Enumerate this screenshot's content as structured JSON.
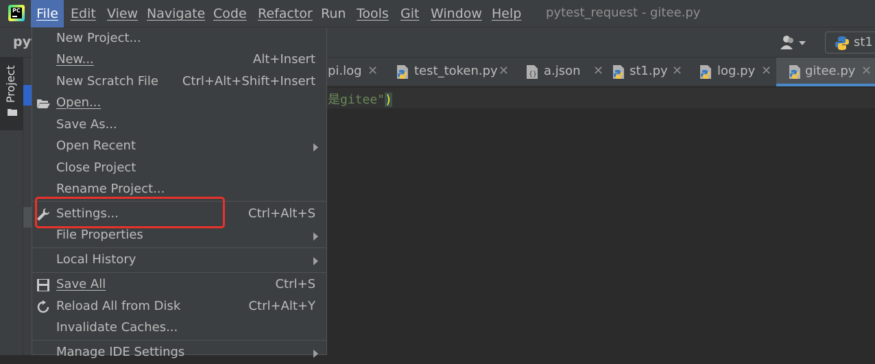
{
  "app": {
    "logo_text": "PC",
    "window_title": "pytest_request - gitee.py"
  },
  "menubar": {
    "items": [
      {
        "label": "File",
        "mnemonic": "F"
      },
      {
        "label": "Edit",
        "mnemonic": "E"
      },
      {
        "label": "View",
        "mnemonic": "V"
      },
      {
        "label": "Navigate",
        "mnemonic": "N"
      },
      {
        "label": "Code",
        "mnemonic": "C"
      },
      {
        "label": "Refactor",
        "mnemonic": "R"
      },
      {
        "label": "Run",
        "mnemonic": "u"
      },
      {
        "label": "Tools",
        "mnemonic": "T"
      },
      {
        "label": "Git",
        "mnemonic": "G"
      },
      {
        "label": "Window",
        "mnemonic": "W"
      },
      {
        "label": "Help",
        "mnemonic": "H"
      }
    ]
  },
  "navbar": {
    "project_crumb": "pyt",
    "run_config_label": "st1"
  },
  "toolstrip": {
    "project_tab_label": "Project"
  },
  "tabs": [
    {
      "label": "pi.log",
      "icon": "log-file-icon"
    },
    {
      "label": "test_token.py",
      "icon": "python-file-icon"
    },
    {
      "label": "a.json",
      "icon": "json-file-icon"
    },
    {
      "label": "st1.py",
      "icon": "python-file-icon"
    },
    {
      "label": "log.py",
      "icon": "python-file-icon"
    },
    {
      "label": "gitee.py",
      "icon": "python-file-icon",
      "active": true
    }
  ],
  "editor": {
    "code_string": "是gitee\"",
    "code_paren": ")"
  },
  "file_menu": {
    "items": [
      {
        "label": "New Project...",
        "shortcut": ""
      },
      {
        "label": "New...",
        "shortcut": "Alt+Insert",
        "underline": "N"
      },
      {
        "label": "New Scratch File",
        "shortcut": "Ctrl+Alt+Shift+Insert"
      },
      {
        "label": "Open...",
        "shortcut": "",
        "icon": "folder-open-icon",
        "underline": "O"
      },
      {
        "label": "Save As...",
        "shortcut": ""
      },
      {
        "label": "Open Recent",
        "shortcut": "",
        "submenu": true,
        "underline": "R"
      },
      {
        "label": "Close Project",
        "shortcut": ""
      },
      {
        "label": "Rename Project...",
        "shortcut": ""
      },
      {
        "label": "Settings...",
        "shortcut": "Ctrl+Alt+S",
        "icon": "wrench-icon",
        "underline": "t"
      },
      {
        "label": "File Properties",
        "shortcut": "",
        "submenu": true
      },
      {
        "label": "Local History",
        "shortcut": "",
        "submenu": true,
        "underline": "H"
      },
      {
        "label": "Save All",
        "shortcut": "Ctrl+S",
        "icon": "save-icon",
        "underline": "S"
      },
      {
        "label": "Reload All from Disk",
        "shortcut": "Ctrl+Alt+Y",
        "icon": "reload-icon"
      },
      {
        "label": "Invalidate Caches...",
        "shortcut": ""
      },
      {
        "label": "Manage IDE Settings",
        "shortcut": "",
        "submenu": true
      }
    ]
  },
  "colors": {
    "menu_bg": "#3c3f41",
    "editor_bg": "#2b2b2b",
    "active_menu": "#4b6eaf",
    "highlight_annotation": "#e8322a"
  }
}
